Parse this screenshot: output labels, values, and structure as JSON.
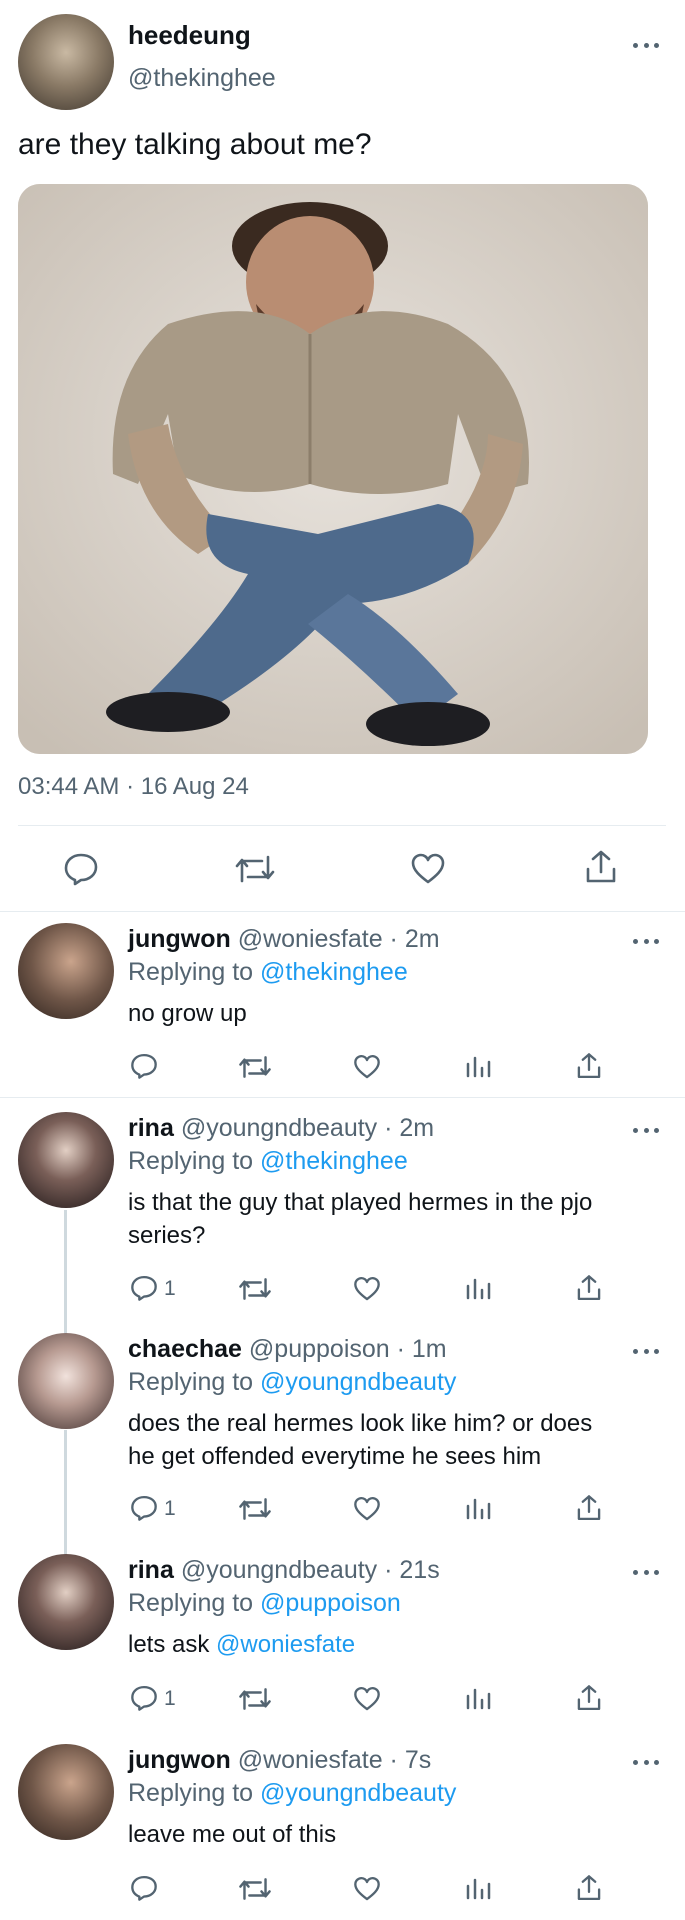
{
  "main_tweet": {
    "display_name": "heedeung",
    "handle": "@thekinghee",
    "text": "are they talking about me?",
    "timestamp": "03:44 AM · 16 Aug 24",
    "image_icon": "photo-man-in-shirt-and-jeans"
  },
  "replies": [
    {
      "name": "jungwon",
      "meta": "@woniesfate · 2m",
      "replying_prefix": "Replying to ",
      "replying_to": "@thekinghee",
      "text": "no grow up",
      "reply_count": ""
    },
    {
      "name": "rina",
      "meta": "@youngndbeauty · 2m",
      "replying_prefix": "Replying to ",
      "replying_to": "@thekinghee",
      "text_line1": "is that the guy that played hermes in the pjo",
      "text_line2": "series?",
      "reply_count": "1"
    },
    {
      "name": "chaechae",
      "meta": "@puppoison · 1m",
      "replying_prefix": "Replying to ",
      "replying_to": "@youngndbeauty",
      "text_line1": "does the real hermes look like him? or does",
      "text_line2": "he get offended everytime he sees him",
      "reply_count": "1"
    },
    {
      "name": "rina",
      "meta": "@youngndbeauty · 21s",
      "replying_prefix": "Replying to ",
      "replying_to": "@puppoison",
      "text_prefix": "lets ask ",
      "text_mention": "@woniesfate",
      "reply_count": "1"
    },
    {
      "name": "jungwon",
      "meta": "@woniesfate · 7s",
      "replying_prefix": "Replying to ",
      "replying_to": "@youngndbeauty",
      "text": "leave me out of this",
      "reply_count": ""
    }
  ],
  "colors": {
    "accent": "#1d9bf0",
    "secondary_text": "#536471",
    "divider": "#e6ecf0"
  }
}
